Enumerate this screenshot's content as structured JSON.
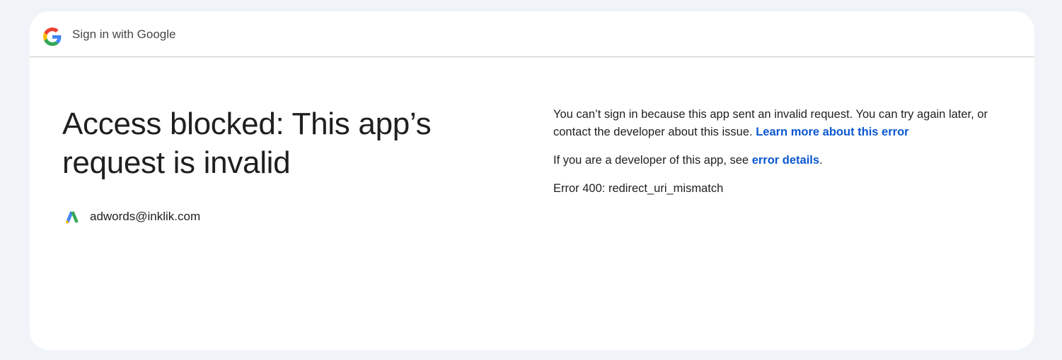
{
  "header": {
    "title": "Sign in with Google",
    "logo_icon": "google-g-icon"
  },
  "main": {
    "headline_line1": "Access blocked: This app’s",
    "headline_line2": "request is invalid",
    "account": {
      "email": "adwords@inklik.com",
      "app_icon": "google-ads-icon"
    },
    "message": {
      "text": "You can’t sign in because this app sent an invalid request. You can try again later, or contact the developer about this issue.",
      "learn_more_link": "Learn more about this error"
    },
    "developer_note": {
      "prefix": "If you are a developer of this app, see",
      "link": "error details",
      "suffix": "."
    },
    "error_code": "Error 400: redirect_uri_mismatch"
  },
  "colors": {
    "background": "#f0f4f9",
    "card": "#ffffff",
    "link": "#0b57d0",
    "google_blue": "#4285F4",
    "google_red": "#EA4335",
    "google_yellow": "#FBBC05",
    "google_green": "#34A853"
  }
}
